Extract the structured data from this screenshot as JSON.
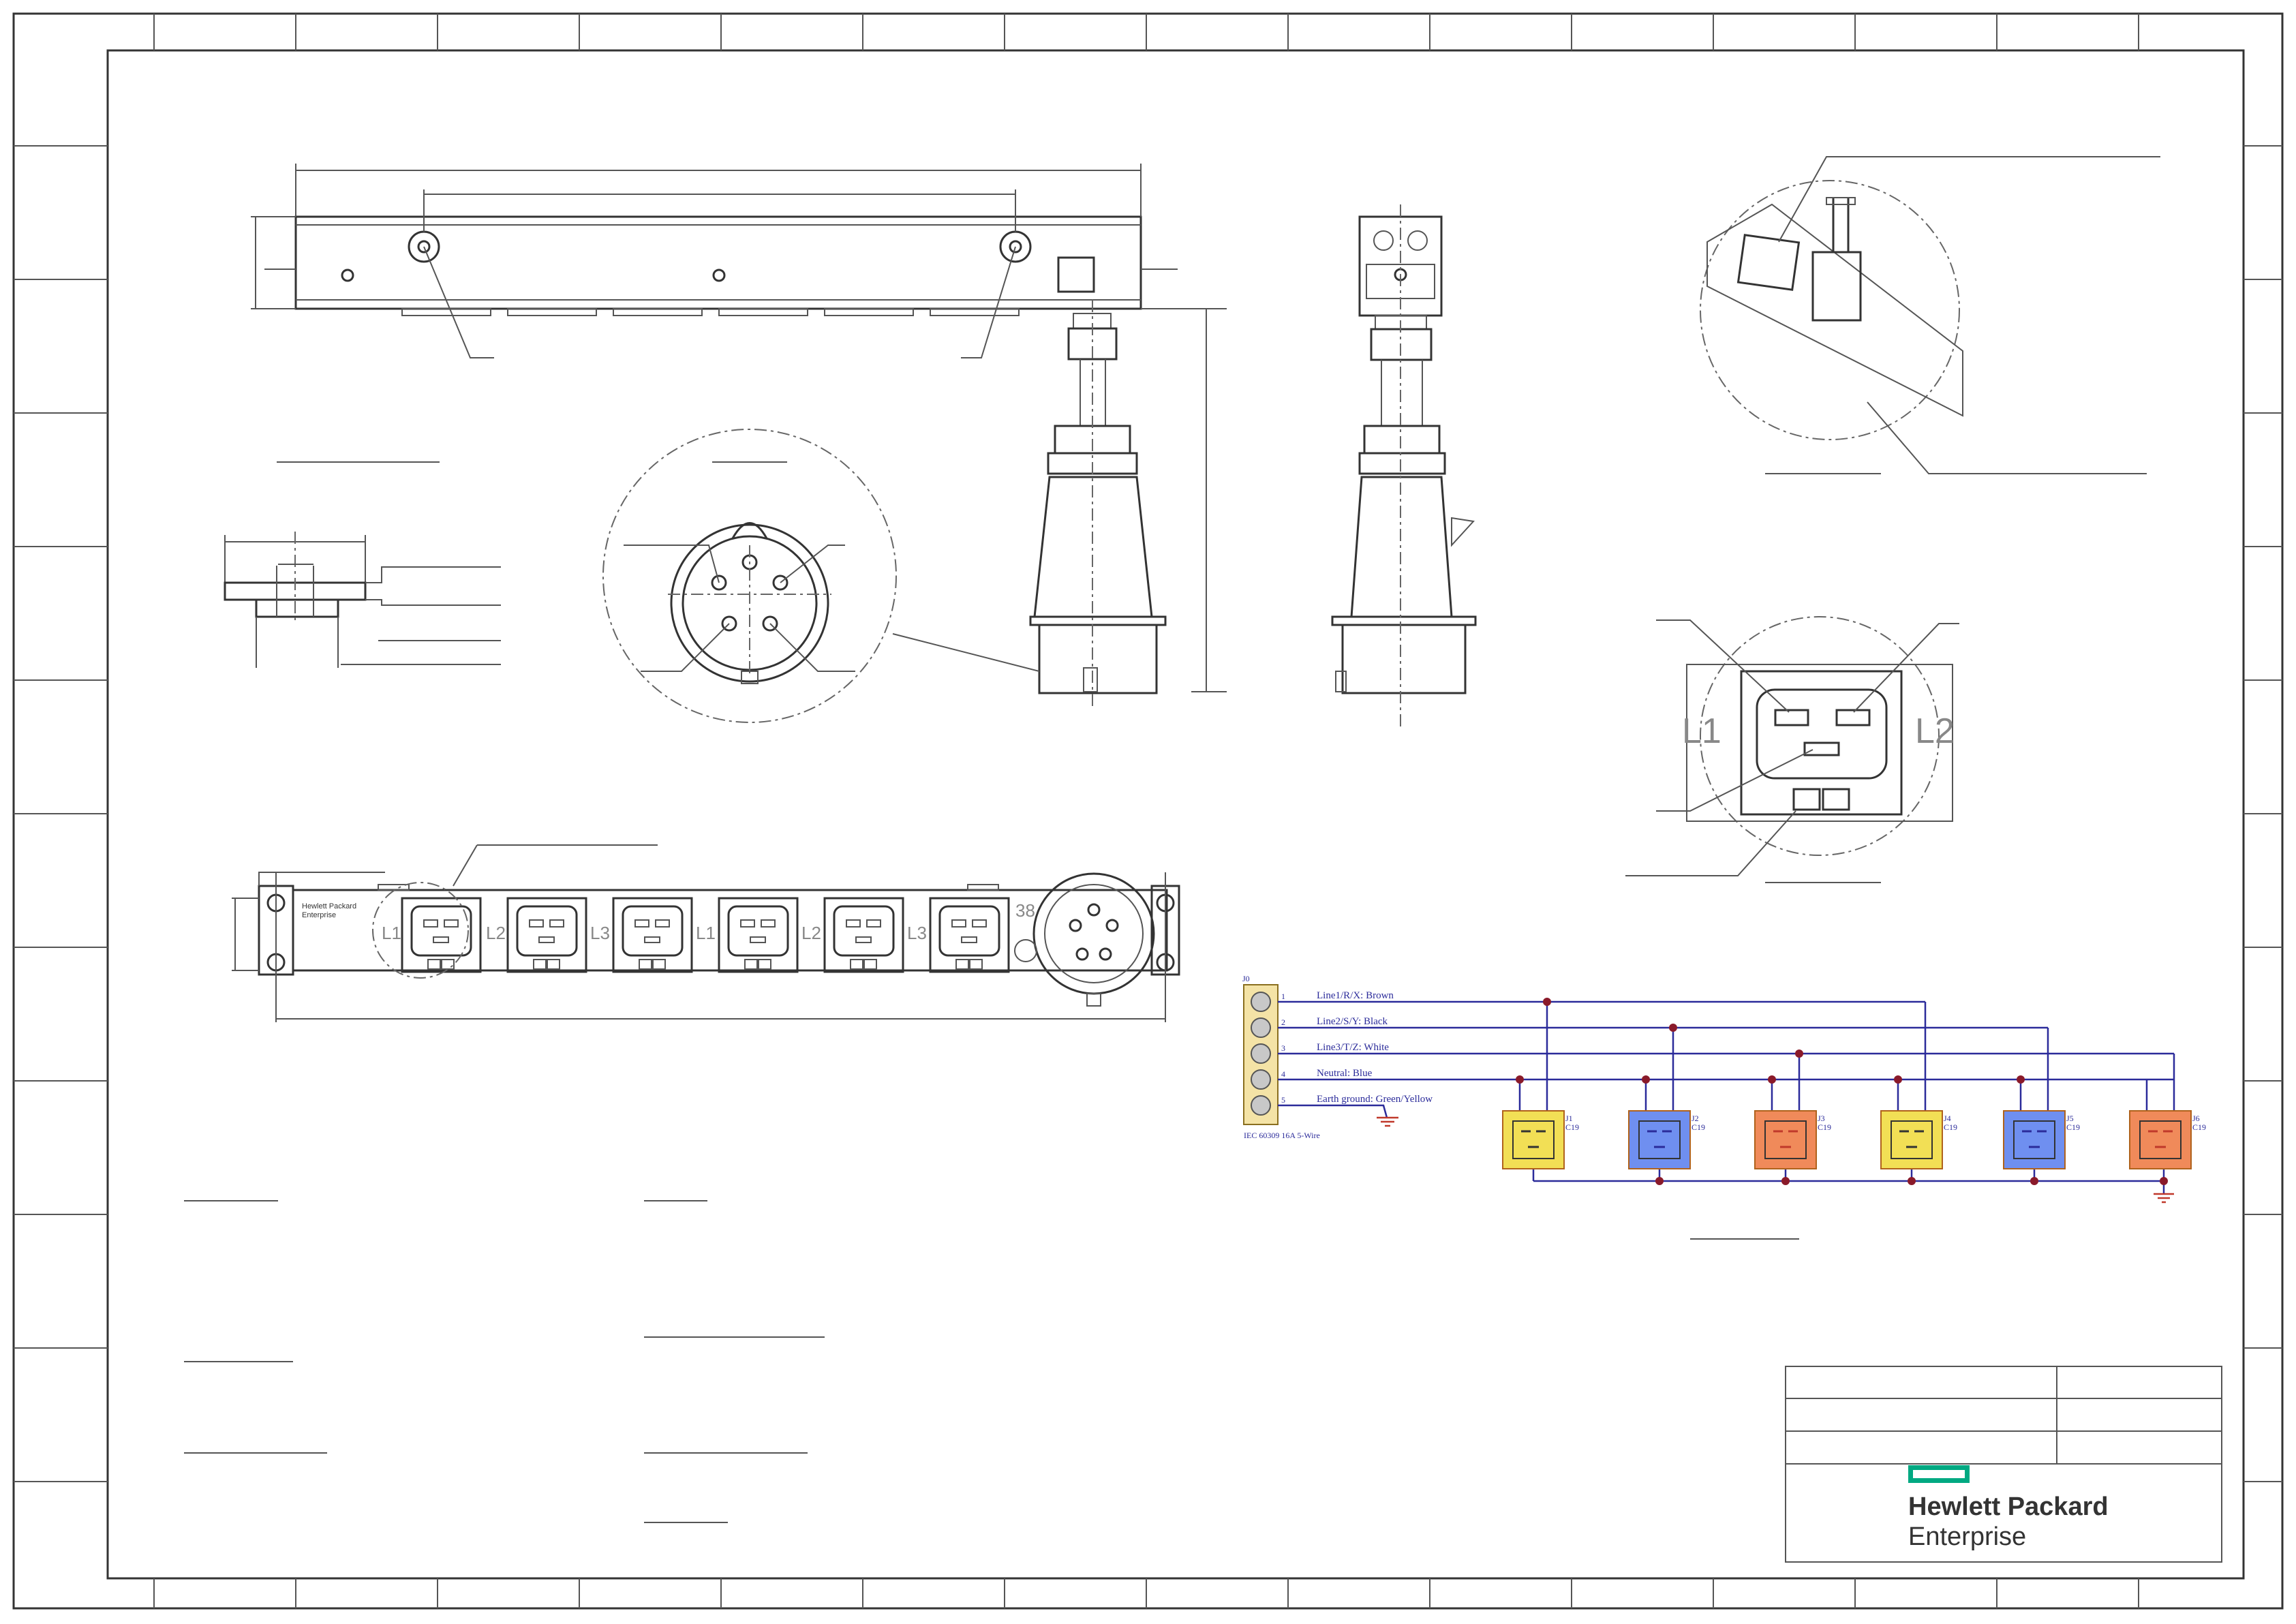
{
  "brand": {
    "line1": "Hewlett Packard",
    "line2": "Enterprise",
    "color": "#01a982"
  },
  "front_view": {
    "plate_text1": "Hewlett Packard",
    "plate_text2": "Enterprise",
    "outlet_labels": [
      "L1",
      "L2",
      "L3",
      "L1",
      "L2",
      "L3"
    ],
    "inlet_marking": "38"
  },
  "detail_outlet": {
    "left_label": "L1",
    "right_label": "L2"
  },
  "schematic": {
    "connector_ref": "J0",
    "connector_desc": "IEC 60309 16A 5-Wire",
    "pins": [
      "1",
      "2",
      "3",
      "4",
      "5"
    ],
    "wires": [
      "Line1/R/X: Brown",
      "Line2/S/Y: Black",
      "Line3/T/Z: White",
      "Neutral: Blue",
      "Earth ground: Green/Yellow"
    ],
    "outlets": [
      {
        "ref": "J1",
        "type": "C19",
        "color": "#f2df55"
      },
      {
        "ref": "J2",
        "type": "C19",
        "color": "#6f8ff0"
      },
      {
        "ref": "J3",
        "type": "C19",
        "color": "#f08a5a"
      },
      {
        "ref": "J4",
        "type": "C19",
        "color": "#f2df55"
      },
      {
        "ref": "J5",
        "type": "C19",
        "color": "#6f8ff0"
      },
      {
        "ref": "J6",
        "type": "C19",
        "color": "#f08a5a"
      }
    ]
  }
}
